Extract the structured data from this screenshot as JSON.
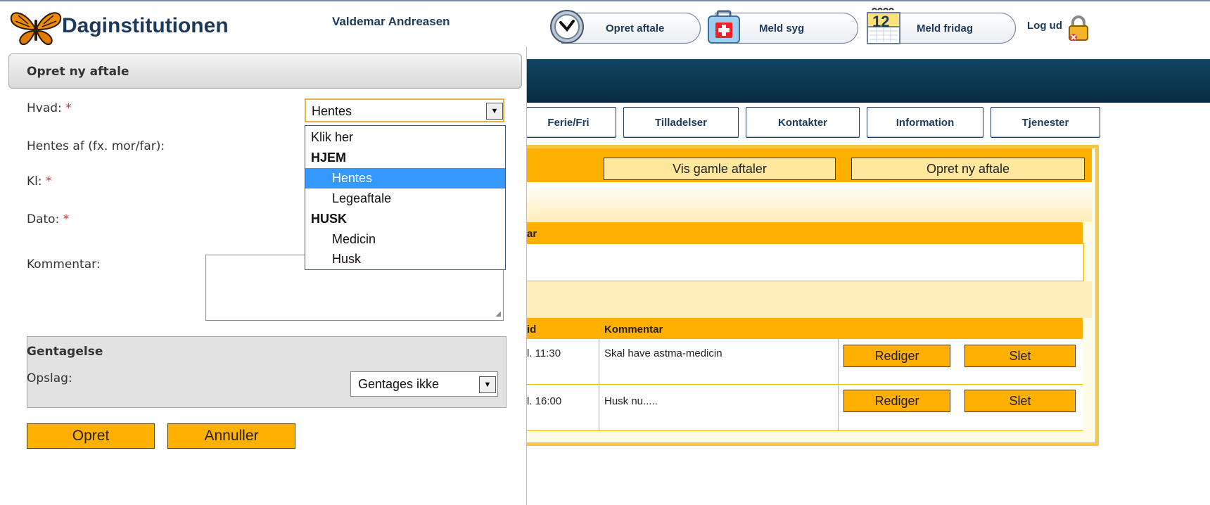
{
  "header": {
    "app_title": "Daginstitutionen",
    "user_name": "Valdemar Andreasen",
    "actions": [
      {
        "label": "Opret aftale",
        "icon": "clock-icon"
      },
      {
        "label": "Meld syg",
        "icon": "first-aid-icon"
      },
      {
        "label": "Meld fridag",
        "icon": "calendar-icon"
      }
    ],
    "logout_label": "Log ud",
    "calendar_day": "12"
  },
  "background": {
    "tabs": [
      "Ferie/Fri",
      "Tilladelser",
      "Kontakter",
      "Information",
      "Tjenester"
    ],
    "buttons": {
      "vis_gamle": "Vis gamle aftaler",
      "opret_ny": "Opret ny aftale"
    },
    "section_header_fragment": "ar",
    "table": {
      "columns": [
        "id",
        "Kommentar"
      ],
      "rows": [
        {
          "time": "l. 11:30",
          "comment": "Skal have astma-medicin",
          "edit": "Rediger",
          "delete": "Slet"
        },
        {
          "time": "l. 16:00",
          "comment": "Husk nu.....",
          "edit": "Rediger",
          "delete": "Slet"
        }
      ]
    }
  },
  "dialog": {
    "title": "Opret ny aftale",
    "required_mark": "*",
    "fields": {
      "hvad_label": "Hvad:",
      "hentes_af_label": "Hentes af (fx. mor/far):",
      "kl_label": "Kl:",
      "dato_label": "Dato:",
      "kommentar_label": "Kommentar:"
    },
    "hvad_select": {
      "value": "Hentes",
      "options": [
        {
          "label": "Klik her",
          "kind": "option"
        },
        {
          "label": "HJEM",
          "kind": "group"
        },
        {
          "label": "Hentes",
          "kind": "sub",
          "selected": true
        },
        {
          "label": "Legeaftale",
          "kind": "sub"
        },
        {
          "label": "HUSK",
          "kind": "group"
        },
        {
          "label": "Medicin",
          "kind": "sub"
        },
        {
          "label": "Husk",
          "kind": "sub"
        }
      ]
    },
    "kommentar_value": "",
    "gentagelse": {
      "title": "Gentagelse",
      "opslag_label": "Opslag:",
      "opslag_value": "Gentages ikke"
    },
    "buttons": {
      "opret": "Opret",
      "annuller": "Annuller"
    }
  },
  "colors": {
    "accent_orange": "#ffb000",
    "nav_dark": "#0b3a55",
    "selection_blue": "#3399ff",
    "required_red": "#e03030"
  }
}
